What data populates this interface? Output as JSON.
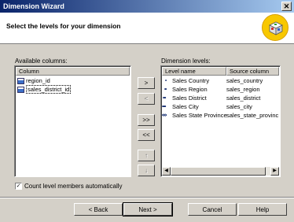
{
  "window": {
    "title": "Dimension Wizard"
  },
  "header": {
    "text": "Select the levels for your dimension",
    "icon": "cube-icon"
  },
  "available": {
    "label": "Available columns:",
    "column_header": "Column",
    "items": [
      {
        "label": "region_id"
      },
      {
        "label": "sales_district_id"
      }
    ]
  },
  "dimension": {
    "label": "Dimension levels:",
    "headers": [
      "Level name",
      "Source column"
    ],
    "rows": [
      {
        "icon": "•",
        "name": "Sales Country",
        "source": "sales_country"
      },
      {
        "icon": "••",
        "name": "Sales Region",
        "source": "sales_region"
      },
      {
        "icon": "•••",
        "name": "Sales District",
        "source": "sales_district"
      },
      {
        "icon": "••••",
        "name": "Sales City",
        "source": "sales_city"
      },
      {
        "icon": "•:•:•",
        "name": "Sales State Province",
        "source": "sales_state_provinc"
      }
    ]
  },
  "move_buttons": {
    "add": ">",
    "remove": "<",
    "add_all": ">>",
    "remove_all": "<<",
    "move_up": "↑",
    "move_down": "↓"
  },
  "checkbox": {
    "label": "Count level members automatically",
    "checked": true,
    "mark": "✓"
  },
  "buttons": {
    "back": "< Back",
    "next": "Next >",
    "cancel": "Cancel",
    "help": "Help"
  },
  "scrollbar": {
    "left_arrow": "◀",
    "right_arrow": "▶"
  }
}
